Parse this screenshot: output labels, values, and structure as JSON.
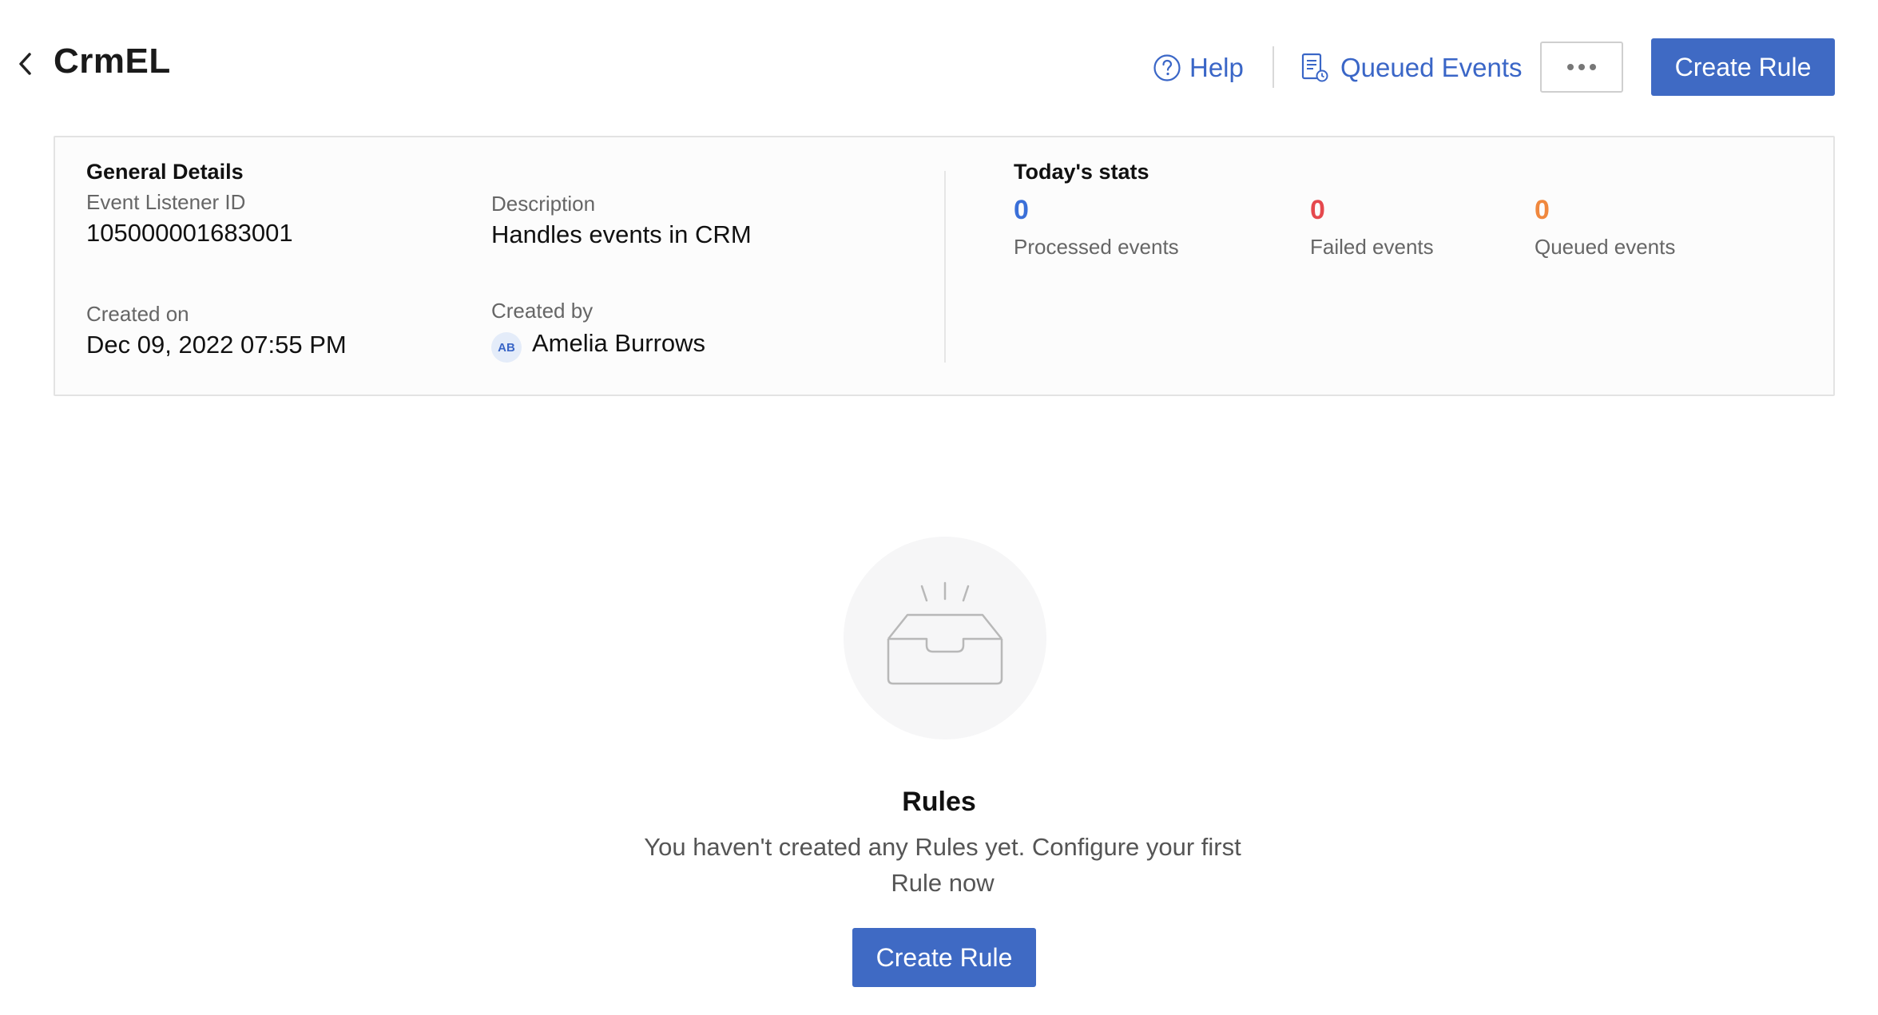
{
  "header": {
    "title": "CrmEL",
    "help_label": "Help",
    "queued_events_label": "Queued Events",
    "create_rule_label": "Create Rule"
  },
  "general_details": {
    "title": "General Details",
    "event_listener_id_label": "Event Listener ID",
    "event_listener_id": "105000001683001",
    "description_label": "Description",
    "description": "Handles events in CRM",
    "created_on_label": "Created on",
    "created_on": "Dec 09, 2022 07:55 PM",
    "created_by_label": "Created by",
    "created_by_initials": "AB",
    "created_by": "Amelia Burrows"
  },
  "todays_stats": {
    "title": "Today's stats",
    "stats": [
      {
        "value": "0",
        "label": "Processed events",
        "color": "#3a6fd8"
      },
      {
        "value": "0",
        "label": "Failed events",
        "color": "#e5484d"
      },
      {
        "value": "0",
        "label": "Queued events",
        "color": "#f0883e"
      }
    ]
  },
  "empty_state": {
    "title": "Rules",
    "description": "You haven't created any Rules yet. Configure your first Rule now",
    "button_label": "Create Rule"
  },
  "colors": {
    "accent": "#3f6ac4",
    "link": "#3a66c7"
  }
}
